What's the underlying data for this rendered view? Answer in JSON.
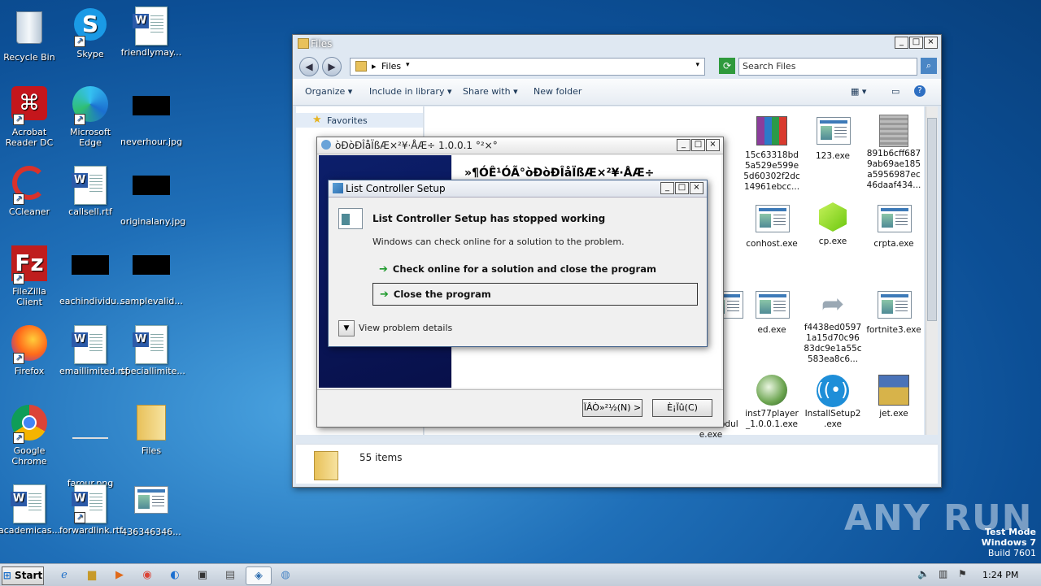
{
  "desktop": {
    "icons": [
      {
        "label": "Recycle Bin"
      },
      {
        "label": "Skype"
      },
      {
        "label": "friendlymay..."
      },
      {
        "label": "Acrobat Reader DC"
      },
      {
        "label": "Microsoft Edge"
      },
      {
        "label": "neverhour.jpg"
      },
      {
        "label": "CCleaner"
      },
      {
        "label": "callsell.rtf"
      },
      {
        "label": "originalany.jpg"
      },
      {
        "label": "FileZilla Client"
      },
      {
        "label": "eachindividu..."
      },
      {
        "label": "samplevalid..."
      },
      {
        "label": "Firefox"
      },
      {
        "label": "emaillimited.rtf"
      },
      {
        "label": "speciallimite..."
      },
      {
        "label": "Google Chrome"
      },
      {
        "label": "farour.png"
      },
      {
        "label": "Files"
      },
      {
        "label": "academicas..."
      },
      {
        "label": "forwardlink.rtf"
      },
      {
        "label": "436346346..."
      }
    ],
    "watermark": {
      "brand": "ANY RUN",
      "mode": "Test Mode",
      "os": "Windows 7",
      "build": "Build 7601"
    }
  },
  "explorer": {
    "title": "Files",
    "breadcrumb": "Files",
    "search_placeholder": "Search Files",
    "commands": [
      "Organize",
      "Include in library",
      "Share with",
      "New folder"
    ],
    "favorites": "Favorites",
    "status": "55 items",
    "files": [
      {
        "name": "15c63318bd 5a529e599e 5d60302f2dc 14961ebcc..."
      },
      {
        "name": "123.exe"
      },
      {
        "name": "891b6cff687 9ab69ae185 a5956987ec 46daaf434..."
      },
      {
        "name": "conhost.exe"
      },
      {
        "name": "cp.exe"
      },
      {
        "name": "crpta.exe"
      },
      {
        "name": "exe"
      },
      {
        "name": "ed.exe"
      },
      {
        "name": "f4438ed0597 1a15d70c96 83dc9e1a55c 583ea8c6..."
      },
      {
        "name": "fortnite3.exe"
      },
      {
        "name": "rvi ce%20Modul e.exe"
      },
      {
        "name": "inst77player _1.0.0.1.exe"
      },
      {
        "name": "InstallSetup2 .exe"
      },
      {
        "name": "jet.exe"
      },
      {
        "name": "e"
      }
    ]
  },
  "installer": {
    "title": "òÐòÐÎåÏßÆ×²¥·ÅÆ÷ 1.0.0.1 °²×°",
    "heading": "»¶Ó­Ê¹ÓÃ°òÐòÐÎåÏßÆ×²¥·ÅÆ÷",
    "next_button": "ÏÂÒ»²½(N) >",
    "cancel_button": "È¡Ïû(C)"
  },
  "error_dialog": {
    "title": "List Controller Setup",
    "heading": "List Controller Setup has stopped working",
    "message": "Windows can check online for a solution to the problem.",
    "option1": "Check online for a solution and close the program",
    "option2": "Close the program",
    "details": "View problem details"
  },
  "taskbar": {
    "start": "Start",
    "time": "1:24 PM"
  }
}
